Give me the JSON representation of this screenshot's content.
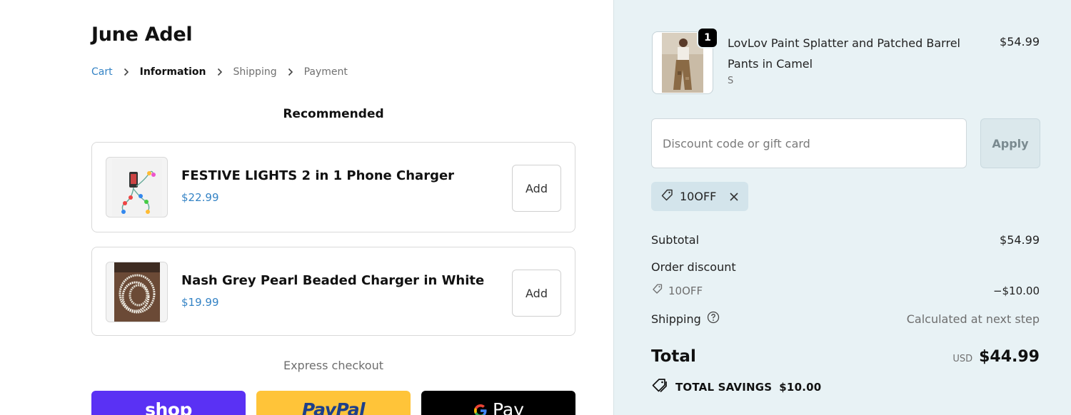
{
  "store": {
    "name": "June Adel"
  },
  "breadcrumb": [
    {
      "label": "Cart"
    },
    {
      "label": "Information"
    },
    {
      "label": "Shipping"
    },
    {
      "label": "Payment"
    }
  ],
  "recommended": {
    "title": "Recommended",
    "items": [
      {
        "name": "FESTIVE LIGHTS 2 in 1 Phone Charger",
        "price": "$22.99",
        "add_label": "Add"
      },
      {
        "name": "Nash Grey Pearl Beaded Charger in White",
        "price": "$19.99",
        "add_label": "Add"
      }
    ]
  },
  "express": {
    "label": "Express checkout",
    "buttons": [
      {
        "label": "shop",
        "color": "#5a31f4"
      },
      {
        "label": "PayPal",
        "color": "#ffc439"
      },
      {
        "label": "Pay",
        "color": "#000000"
      }
    ]
  },
  "summary": {
    "item": {
      "quantity": "1",
      "name": "LovLov Paint Splatter and Patched Barrel Pants in Camel",
      "variant": "S",
      "price": "$54.99"
    },
    "discount": {
      "placeholder": "Discount code or gift card",
      "apply_label": "Apply",
      "applied_code": "10OFF"
    },
    "subtotal": {
      "label": "Subtotal",
      "value": "$54.99"
    },
    "order_discount": {
      "label": "Order discount",
      "code": "10OFF",
      "value": "−$10.00"
    },
    "shipping": {
      "label": "Shipping",
      "value": "Calculated at next step"
    },
    "total": {
      "label": "Total",
      "currency": "USD",
      "value": "$44.99"
    },
    "savings": {
      "label": "TOTAL SAVINGS",
      "value": "$10.00"
    }
  },
  "colors": {
    "link": "#3483c5",
    "summary_bg": "#e8f2f5",
    "shop_pay": "#5a31f4",
    "paypal": "#ffc439",
    "gpay": "#000000"
  }
}
